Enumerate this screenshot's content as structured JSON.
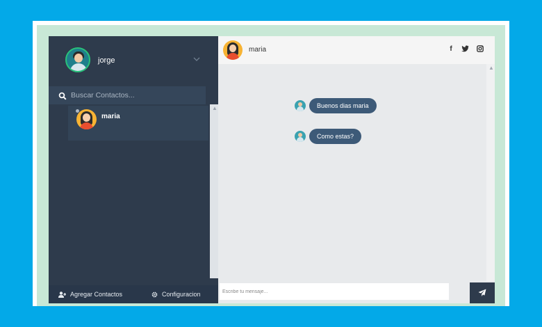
{
  "user": {
    "name": "jorge"
  },
  "search": {
    "placeholder": "Buscar Contactos..."
  },
  "contacts": [
    {
      "name": "maria"
    }
  ],
  "bottom_bar": {
    "add_contacts_label": "Agregar Contactos",
    "settings_label": "Configuracion"
  },
  "chat": {
    "contact_name": "maria",
    "messages": [
      {
        "text": "Buenos dias maria"
      },
      {
        "text": "Como estas?"
      }
    ],
    "input_placeholder": "Escribe tu mensaje..."
  },
  "icons": {
    "search": "search-icon",
    "chevron": "chevron-down-icon",
    "add_user": "add-user-icon",
    "settings": "gear-icon",
    "facebook": "facebook-icon",
    "twitter": "twitter-icon",
    "instagram": "instagram-icon",
    "send": "paper-plane-icon"
  },
  "colors": {
    "background": "#03a9e8",
    "sidebar": "#2e3b4c",
    "bubble": "#3d5a78",
    "online_ring": "#29c27a"
  }
}
